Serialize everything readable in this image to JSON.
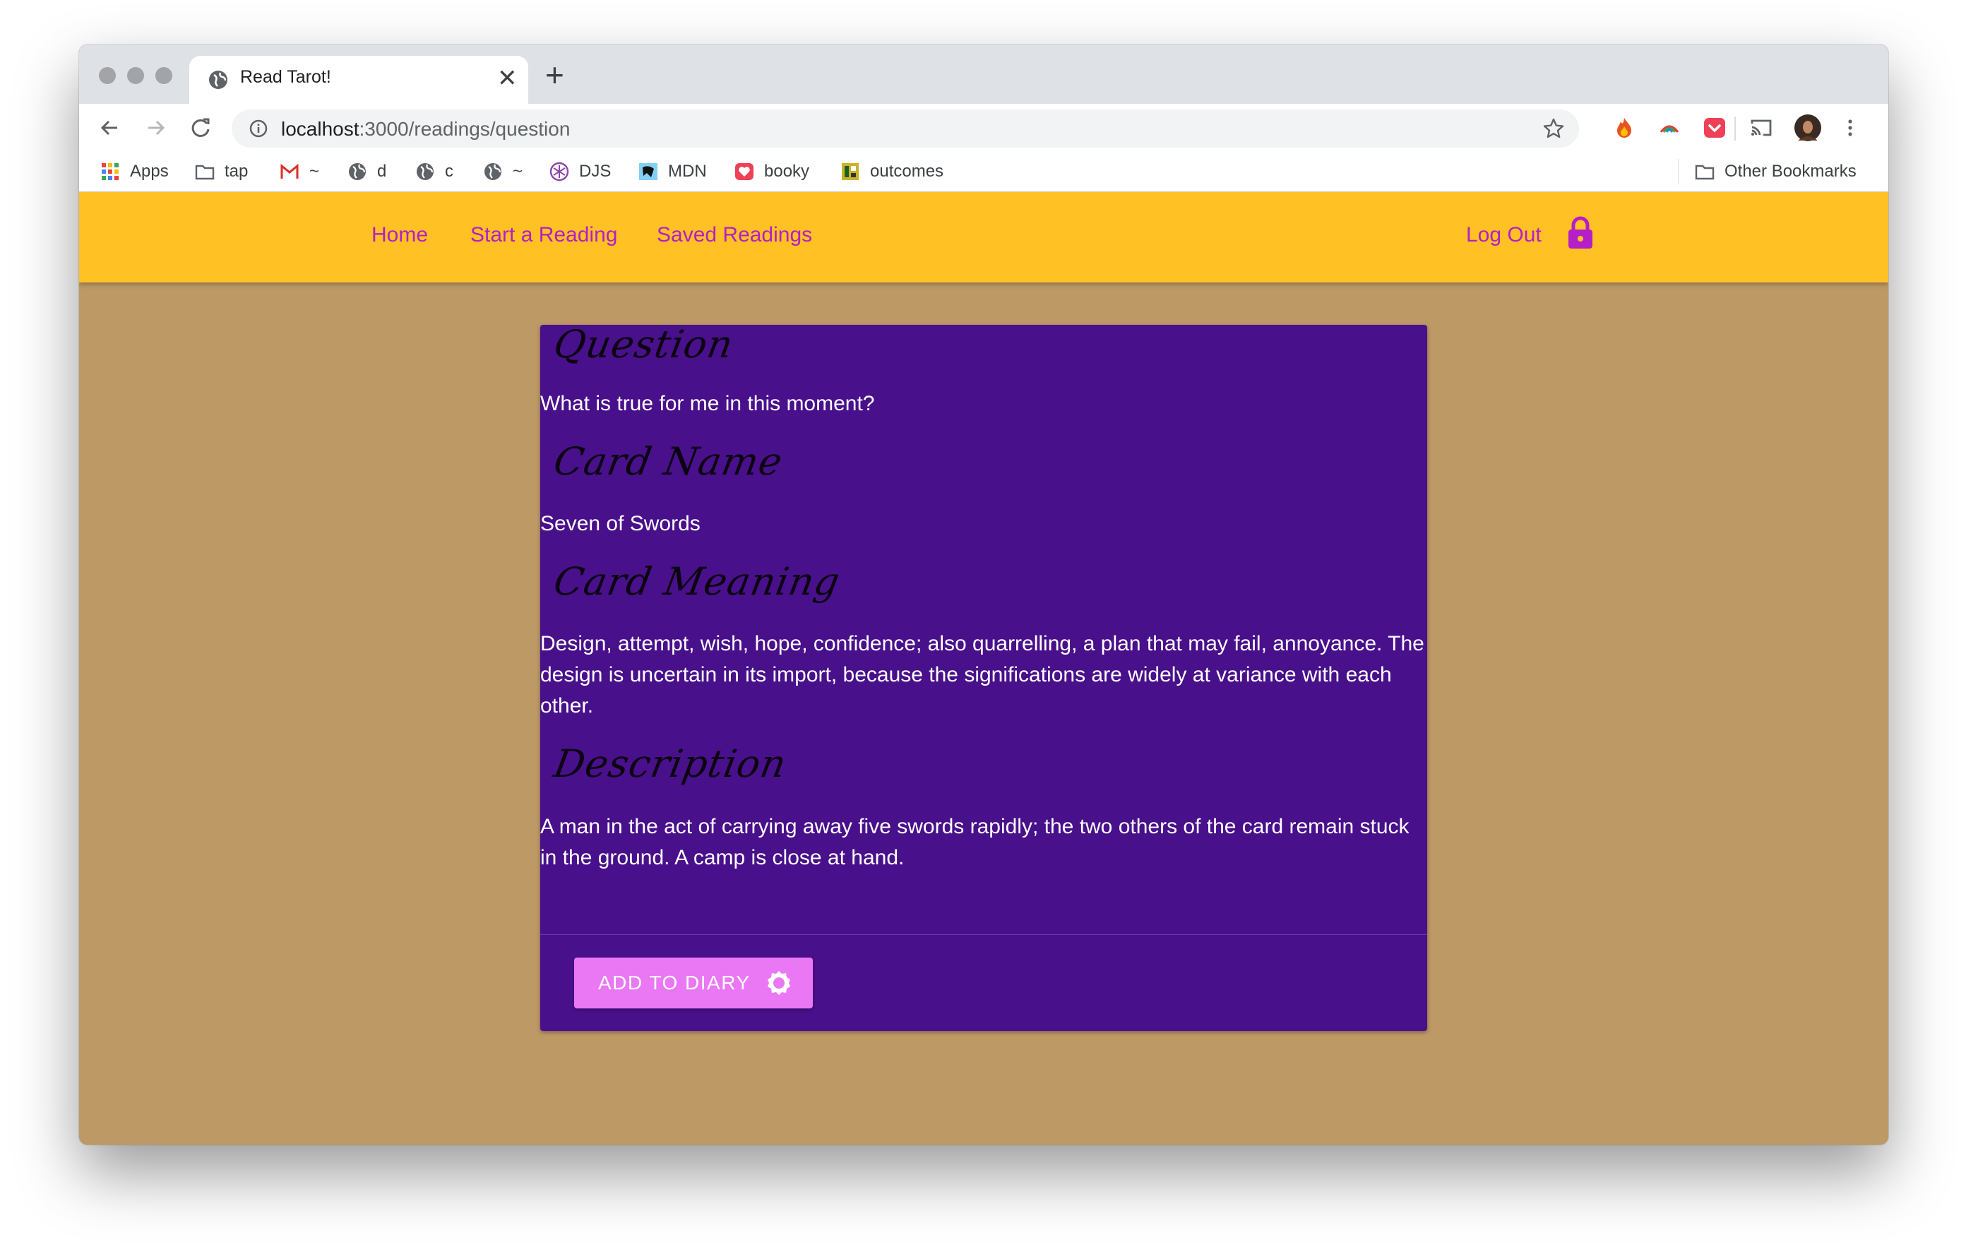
{
  "browser": {
    "tab_title": "Read Tarot!",
    "tab_close": "✕",
    "new_tab": "+",
    "url_host": "localhost",
    "url_path": ":3000/readings/question",
    "bookmarks": [
      {
        "label": "Apps",
        "icon": "apps-grid-icon"
      },
      {
        "label": "tap",
        "icon": "folder-icon"
      },
      {
        "label": "~",
        "icon": "gmail-icon"
      },
      {
        "label": "d",
        "icon": "globe-icon"
      },
      {
        "label": "c",
        "icon": "globe-icon"
      },
      {
        "label": "~",
        "icon": "globe-icon"
      },
      {
        "label": "DJS",
        "icon": "djs-icon"
      },
      {
        "label": "MDN",
        "icon": "mdn-icon"
      },
      {
        "label": "booky",
        "icon": "heart-icon"
      },
      {
        "label": "outcomes",
        "icon": "outcomes-icon"
      }
    ],
    "other_bookmarks": "Other Bookmarks"
  },
  "nav": {
    "home": "Home",
    "start_reading": "Start a Reading",
    "saved_readings": "Saved Readings",
    "logout": "Log Out"
  },
  "reading": {
    "question_heading": "Question",
    "question": "What is true for me in this moment?",
    "card_name_heading": "Card Name",
    "card_name": "Seven of Swords",
    "card_meaning_heading": "Card Meaning",
    "card_meaning": "Design, attempt, wish, hope, confidence; also quarrelling, a plan that may fail, annoyance. The design is uncertain in its import, because the significations are widely at variance with each other.",
    "description_heading": "Description",
    "description": "A man in the act of carrying away five swords rapidly; the two others of the card remain stuck in the ground. A camp is close at hand.",
    "add_button": "ADD TO DIARY"
  },
  "colors": {
    "appbar": "#ffc124",
    "nav_link": "#b51fc8",
    "page_bg": "#bd9966",
    "card_bg": "#49108b",
    "button_bg": "#ea78f5"
  }
}
